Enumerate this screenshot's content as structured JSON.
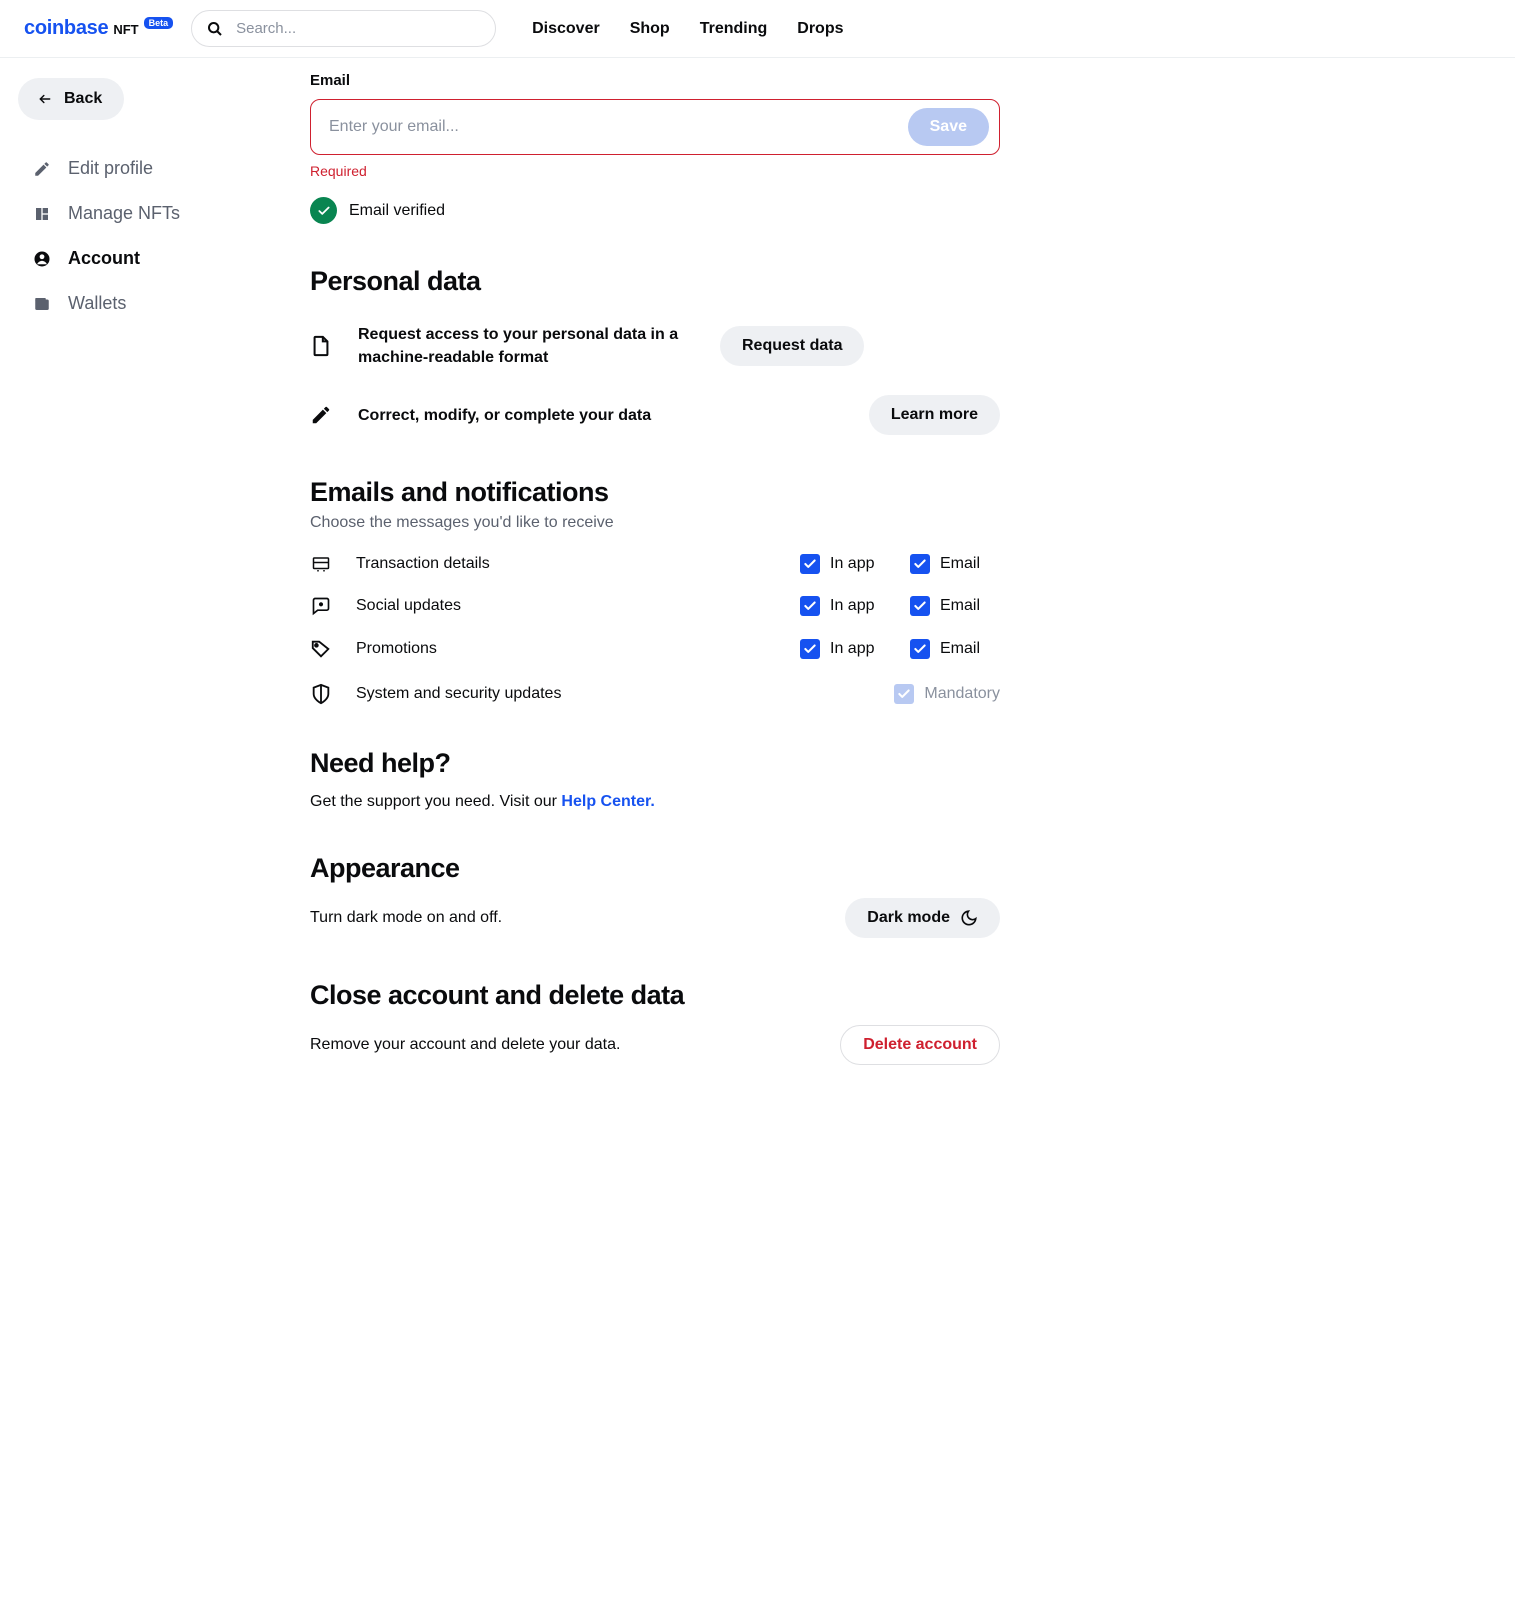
{
  "header": {
    "logo_main": "coinbase",
    "logo_sub": "NFT",
    "beta": "Beta",
    "search_placeholder": "Search...",
    "nav": [
      "Discover",
      "Shop",
      "Trending",
      "Drops"
    ]
  },
  "sidebar": {
    "back": "Back",
    "items": [
      {
        "label": "Edit profile"
      },
      {
        "label": "Manage NFTs"
      },
      {
        "label": "Account"
      },
      {
        "label": "Wallets"
      }
    ]
  },
  "email": {
    "label": "Email",
    "placeholder": "Enter your email...",
    "save": "Save",
    "error": "Required",
    "verified": "Email verified"
  },
  "personal": {
    "title": "Personal data",
    "rows": [
      {
        "desc": "Request access to your personal data in a machine-readable format",
        "btn": "Request data"
      },
      {
        "desc": "Correct, modify, or complete your data",
        "btn": "Learn more"
      }
    ]
  },
  "notifications": {
    "title": "Emails and notifications",
    "sub": "Choose the messages you'd like to receive",
    "col_inapp": "In app",
    "col_email": "Email",
    "mandatory": "Mandatory",
    "rows": [
      {
        "label": "Transaction details"
      },
      {
        "label": "Social updates"
      },
      {
        "label": "Promotions"
      },
      {
        "label": "System and security updates"
      }
    ]
  },
  "help": {
    "title": "Need help?",
    "text_pre": "Get the support you need. Visit our ",
    "link": "Help Center."
  },
  "appearance": {
    "title": "Appearance",
    "desc": "Turn dark mode on and off.",
    "btn": "Dark mode"
  },
  "close_account": {
    "title": "Close account and delete data",
    "desc": "Remove your account and delete your data.",
    "btn": "Delete account"
  }
}
